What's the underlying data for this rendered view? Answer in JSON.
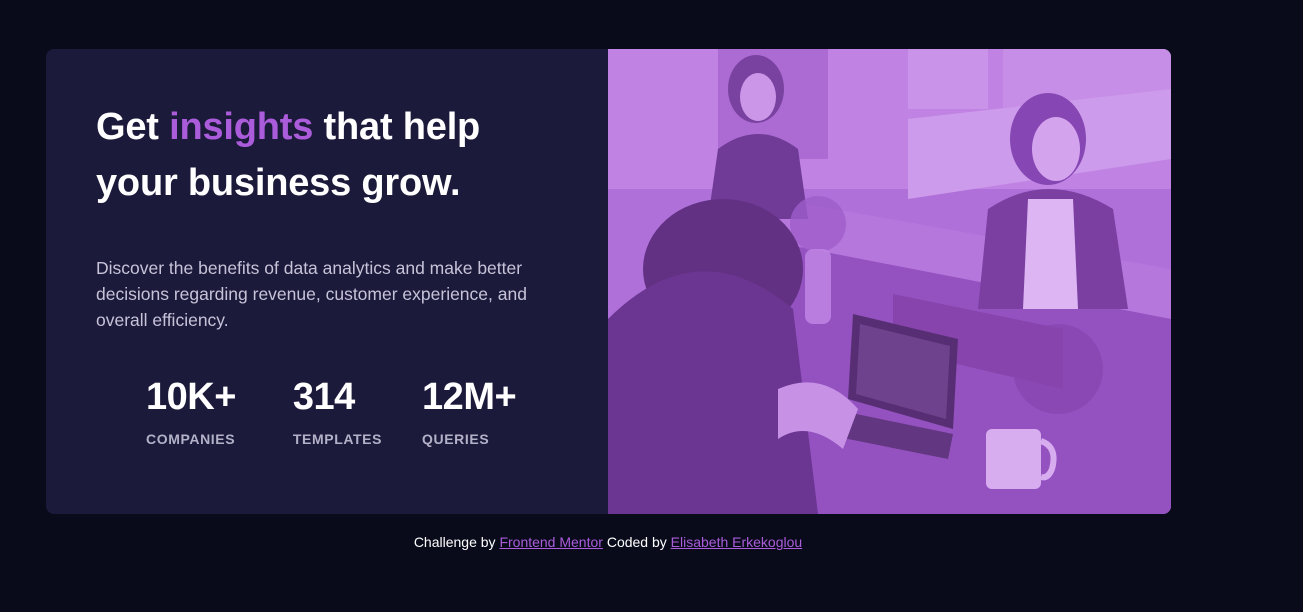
{
  "hero": {
    "headline_before": "Get ",
    "headline_accent": "insights",
    "headline_after": " that help your business grow.",
    "description": "Discover the benefits of data analytics and make better decisions regarding revenue, customer experience, and overall efficiency."
  },
  "stats": [
    {
      "value": "10K+",
      "label": "COMPANIES"
    },
    {
      "value": "314",
      "label": "TEMPLATES"
    },
    {
      "value": "12M+",
      "label": "QUERIES"
    }
  ],
  "image": {
    "icon": "office-photo-image",
    "tint": "#aa5cdb"
  },
  "attribution": {
    "prefix": "Challenge by ",
    "link1": "Frontend Mentor",
    "middle": " Coded by ",
    "link2": "Elisabeth Erkekoglou"
  },
  "colors": {
    "background": "#090b1b",
    "card": "#1c1a3a",
    "accent": "#aa5cdb",
    "text_muted": "#c6c3d9"
  }
}
